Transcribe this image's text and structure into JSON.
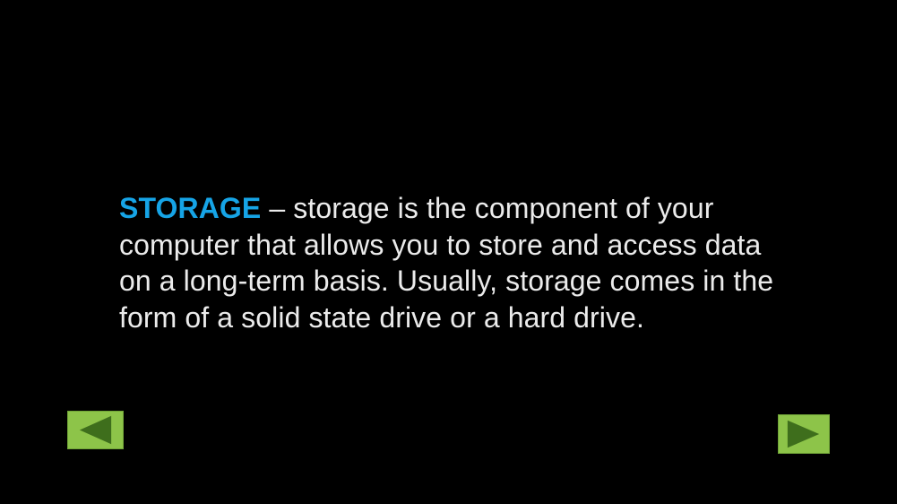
{
  "slide": {
    "term": "STORAGE",
    "definition": " – storage is the component of your computer that allows you to store and access data on a long-term basis. Usually, storage comes in the form of a solid state drive or a hard drive."
  },
  "navigation": {
    "prev_icon": "left-arrow-icon",
    "next_icon": "right-arrow-icon",
    "button_color": "#8dc449",
    "arrow_color": "#3e6e1c"
  },
  "colors": {
    "background": "#000000",
    "term": "#16a4e6",
    "body_text": "#ebebeb"
  }
}
